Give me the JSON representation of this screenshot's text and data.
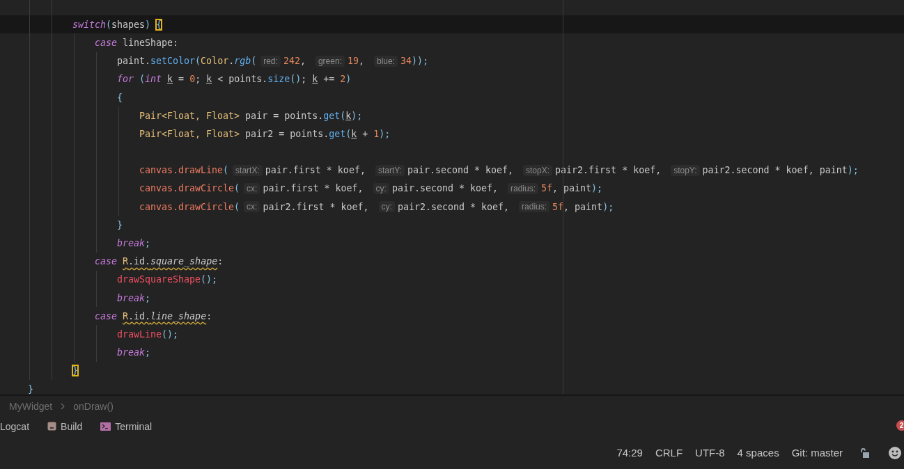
{
  "editor": {
    "lines": [
      {
        "children": [
          {
            "children": [
              {
                "kind": "blank"
              },
              {
                "kind": "code",
                "current": true,
                "tokens": [
                  {
                    "kind": "kw",
                    "text": "switch"
                  },
                  {
                    "kind": "punct",
                    "text": "("
                  },
                  {
                    "kind": "plain",
                    "text": "shapes"
                  },
                  {
                    "kind": "punct",
                    "text": ") "
                  },
                  {
                    "kind": "brace",
                    "text": "{"
                  }
                ],
                "children": [
                  {
                    "kind": "code",
                    "current": false,
                    "tokens": [
                      {
                        "kind": "kw",
                        "text": "case"
                      },
                      {
                        "kind": "plain",
                        "text": " lineShape:"
                      }
                    ],
                    "children": [
                      {
                        "kind": "code",
                        "current": false,
                        "tokens": [
                          {
                            "kind": "plain",
                            "text": "paint."
                          },
                          {
                            "kind": "call",
                            "text": "setColor"
                          },
                          {
                            "kind": "punct",
                            "text": "("
                          },
                          {
                            "kind": "type",
                            "text": "Color"
                          },
                          {
                            "kind": "plain",
                            "text": "."
                          },
                          {
                            "kind": "static",
                            "text": "rgb"
                          },
                          {
                            "kind": "punct",
                            "text": "("
                          },
                          {
                            "kind": "hint",
                            "text": "red:"
                          },
                          {
                            "kind": "num",
                            "text": "242"
                          },
                          {
                            "kind": "plain",
                            "text": ", "
                          },
                          {
                            "kind": "hint",
                            "text": "green:"
                          },
                          {
                            "kind": "num",
                            "text": "19"
                          },
                          {
                            "kind": "plain",
                            "text": ", "
                          },
                          {
                            "kind": "hint",
                            "text": "blue:"
                          },
                          {
                            "kind": "num",
                            "text": "34"
                          },
                          {
                            "kind": "punct",
                            "text": "));"
                          }
                        ]
                      },
                      {
                        "kind": "code",
                        "current": false,
                        "tokens": [
                          {
                            "kind": "kw",
                            "text": "for"
                          },
                          {
                            "kind": "punct",
                            "text": " ("
                          },
                          {
                            "kind": "kw",
                            "text": "int "
                          },
                          {
                            "kind": "under",
                            "text": "k"
                          },
                          {
                            "kind": "plain",
                            "text": " = "
                          },
                          {
                            "kind": "num",
                            "text": "0"
                          },
                          {
                            "kind": "plain",
                            "text": "; "
                          },
                          {
                            "kind": "under",
                            "text": "k"
                          },
                          {
                            "kind": "plain",
                            "text": " < points."
                          },
                          {
                            "kind": "call",
                            "text": "size"
                          },
                          {
                            "kind": "punct",
                            "text": "()"
                          },
                          {
                            "kind": "plain",
                            "text": "; "
                          },
                          {
                            "kind": "under",
                            "text": "k"
                          },
                          {
                            "kind": "plain",
                            "text": " += "
                          },
                          {
                            "kind": "num",
                            "text": "2"
                          },
                          {
                            "kind": "punct",
                            "text": ")"
                          }
                        ]
                      },
                      {
                        "kind": "code",
                        "current": false,
                        "tokens": [
                          {
                            "kind": "punct",
                            "text": "{"
                          }
                        ],
                        "children": [
                          {
                            "kind": "code",
                            "current": false,
                            "tokens": [
                              {
                                "kind": "type",
                                "text": "Pair<Float, Float>"
                              },
                              {
                                "kind": "plain",
                                "text": " pair = points."
                              },
                              {
                                "kind": "call",
                                "text": "get"
                              },
                              {
                                "kind": "punct",
                                "text": "("
                              },
                              {
                                "kind": "under",
                                "text": "k"
                              },
                              {
                                "kind": "punct",
                                "text": ");"
                              }
                            ]
                          },
                          {
                            "kind": "code",
                            "current": false,
                            "tokens": [
                              {
                                "kind": "type",
                                "text": "Pair<Float, Float>"
                              },
                              {
                                "kind": "plain",
                                "text": " pair2 = points."
                              },
                              {
                                "kind": "call",
                                "text": "get"
                              },
                              {
                                "kind": "punct",
                                "text": "("
                              },
                              {
                                "kind": "under",
                                "text": "k"
                              },
                              {
                                "kind": "plain",
                                "text": " + "
                              },
                              {
                                "kind": "num",
                                "text": "1"
                              },
                              {
                                "kind": "punct",
                                "text": ");"
                              }
                            ]
                          },
                          {
                            "kind": "blank"
                          },
                          {
                            "kind": "code",
                            "current": false,
                            "tokens": [
                              {
                                "kind": "field",
                                "text": "canvas.drawLine"
                              },
                              {
                                "kind": "punct",
                                "text": "("
                              },
                              {
                                "kind": "hint",
                                "text": "startX:"
                              },
                              {
                                "kind": "plain",
                                "text": "pair.first * koef, "
                              },
                              {
                                "kind": "hint",
                                "text": "startY:"
                              },
                              {
                                "kind": "plain",
                                "text": "pair.second * koef, "
                              },
                              {
                                "kind": "hint",
                                "text": "stopX:"
                              },
                              {
                                "kind": "plain",
                                "text": "pair2.first * koef, "
                              },
                              {
                                "kind": "hint",
                                "text": "stopY:"
                              },
                              {
                                "kind": "plain",
                                "text": "pair2.second * koef, paint"
                              },
                              {
                                "kind": "punct",
                                "text": ");"
                              }
                            ]
                          },
                          {
                            "kind": "code",
                            "current": false,
                            "tokens": [
                              {
                                "kind": "field",
                                "text": "canvas.drawCircle"
                              },
                              {
                                "kind": "punct",
                                "text": "("
                              },
                              {
                                "kind": "hint",
                                "text": "cx:"
                              },
                              {
                                "kind": "plain",
                                "text": "pair.first * koef, "
                              },
                              {
                                "kind": "hint",
                                "text": "cy:"
                              },
                              {
                                "kind": "plain",
                                "text": "pair.second * koef, "
                              },
                              {
                                "kind": "hint",
                                "text": "radius:"
                              },
                              {
                                "kind": "num",
                                "text": "5f"
                              },
                              {
                                "kind": "plain",
                                "text": ", paint"
                              },
                              {
                                "kind": "punct",
                                "text": ");"
                              }
                            ]
                          },
                          {
                            "kind": "code",
                            "current": false,
                            "tokens": [
                              {
                                "kind": "field",
                                "text": "canvas.drawCircle"
                              },
                              {
                                "kind": "punct",
                                "text": "("
                              },
                              {
                                "kind": "hint",
                                "text": "cx:"
                              },
                              {
                                "kind": "plain",
                                "text": "pair2.first * koef, "
                              },
                              {
                                "kind": "hint",
                                "text": "cy:"
                              },
                              {
                                "kind": "plain",
                                "text": "pair2.second * koef, "
                              },
                              {
                                "kind": "hint",
                                "text": "radius:"
                              },
                              {
                                "kind": "num",
                                "text": "5f"
                              },
                              {
                                "kind": "plain",
                                "text": ", paint"
                              },
                              {
                                "kind": "punct",
                                "text": ");"
                              }
                            ]
                          }
                        ]
                      },
                      {
                        "kind": "code",
                        "current": false,
                        "tokens": [
                          {
                            "kind": "punct",
                            "text": "}"
                          }
                        ]
                      },
                      {
                        "kind": "code",
                        "current": false,
                        "tokens": [
                          {
                            "kind": "kw",
                            "text": "break"
                          },
                          {
                            "kind": "punct",
                            "text": ";"
                          }
                        ]
                      }
                    ]
                  },
                  {
                    "kind": "code",
                    "current": false,
                    "tokens": [
                      {
                        "kind": "kw",
                        "text": "case "
                      },
                      {
                        "kind": "warn-type",
                        "text": "R"
                      },
                      {
                        "kind": "warn",
                        "text": ".id."
                      },
                      {
                        "kind": "warn-italic",
                        "text": "square_shape"
                      },
                      {
                        "kind": "plain",
                        "text": ":"
                      }
                    ],
                    "children": [
                      {
                        "kind": "code",
                        "current": false,
                        "tokens": [
                          {
                            "kind": "method",
                            "text": "drawSquareShape"
                          },
                          {
                            "kind": "punct",
                            "text": "();"
                          }
                        ]
                      },
                      {
                        "kind": "code",
                        "current": false,
                        "tokens": [
                          {
                            "kind": "kw",
                            "text": "break"
                          },
                          {
                            "kind": "punct",
                            "text": ";"
                          }
                        ]
                      }
                    ]
                  },
                  {
                    "kind": "code",
                    "current": false,
                    "tokens": [
                      {
                        "kind": "kw",
                        "text": "case "
                      },
                      {
                        "kind": "warn-type",
                        "text": "R"
                      },
                      {
                        "kind": "warn",
                        "text": ".id."
                      },
                      {
                        "kind": "warn-italic",
                        "text": "line_shape"
                      },
                      {
                        "kind": "plain",
                        "text": ":"
                      }
                    ],
                    "children": [
                      {
                        "kind": "code",
                        "current": false,
                        "tokens": [
                          {
                            "kind": "method",
                            "text": "drawLine"
                          },
                          {
                            "kind": "punct",
                            "text": "();"
                          }
                        ]
                      },
                      {
                        "kind": "code",
                        "current": false,
                        "tokens": [
                          {
                            "kind": "kw",
                            "text": "break"
                          },
                          {
                            "kind": "punct",
                            "text": ";"
                          }
                        ]
                      }
                    ]
                  }
                ]
              },
              {
                "kind": "code",
                "current": false,
                "tokens": [
                  {
                    "kind": "brace",
                    "text": "}"
                  }
                ]
              }
            ]
          }
        ]
      },
      {
        "kind": "code",
        "current": false,
        "tokens": [
          {
            "kind": "punct",
            "text": "}"
          }
        ]
      }
    ]
  },
  "breadcrumbs": [
    "MyWidget",
    "onDraw()"
  ],
  "tool_tabs": [
    {
      "kind": "plain",
      "label": "Logcat"
    },
    {
      "kind": "build",
      "label": "Build"
    },
    {
      "kind": "terminal",
      "label": "Terminal"
    }
  ],
  "notifications": {
    "count": "2"
  },
  "status_bar": [
    "74:29",
    "CRLF",
    "UTF-8",
    "4 spaces",
    "Git: master"
  ]
}
